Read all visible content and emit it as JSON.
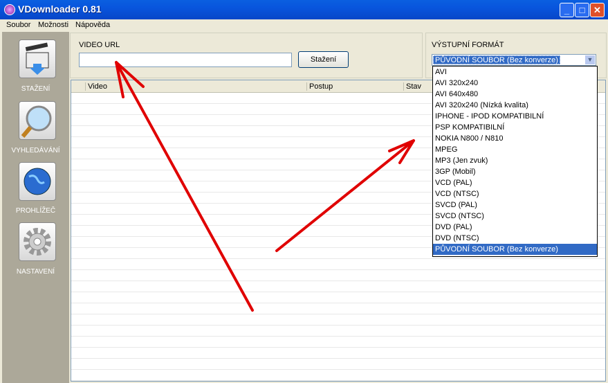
{
  "window": {
    "title": "VDownloader 0.81",
    "buttons": [
      "minimize",
      "maximize",
      "close"
    ]
  },
  "menu": [
    "Soubor",
    "Možnosti",
    "Nápověda"
  ],
  "sidebar": [
    {
      "label": "STAŽENÍ",
      "icon": "clapperboard-download-icon"
    },
    {
      "label": "VYHLEDÁVÁNÍ",
      "icon": "magnifier-icon"
    },
    {
      "label": "PROHLÍŽEČ",
      "icon": "globe-icon"
    },
    {
      "label": "NASTAVENÍ",
      "icon": "gear-icon"
    }
  ],
  "url": {
    "label": "VIDEO URL",
    "value": "",
    "button": "Stažení"
  },
  "format": {
    "label": "VÝSTUPNÍ FORMÁT",
    "selected": "PŮVODNÍ SOUBOR (Bez konverze)",
    "options": [
      "AVI",
      "AVI 320x240",
      "AVI 640x480",
      "AVI 320x240 (Nízká kvalita)",
      "IPHONE - IPOD KOMPATIBILNÍ",
      "PSP KOMPATIBILNÍ",
      "NOKIA N800 / N810",
      "MPEG",
      "MP3 (Jen zvuk)",
      "3GP (Mobil)",
      "VCD (PAL)",
      "VCD (NTSC)",
      "SVCD (PAL)",
      "SVCD (NTSC)",
      "DVD (PAL)",
      "DVD (NTSC)",
      "PŮVODNÍ SOUBOR (Bez konverze)"
    ]
  },
  "table": {
    "columns": [
      "Video",
      "Postup",
      "Stav"
    ]
  },
  "annotation_color": "#e00000"
}
